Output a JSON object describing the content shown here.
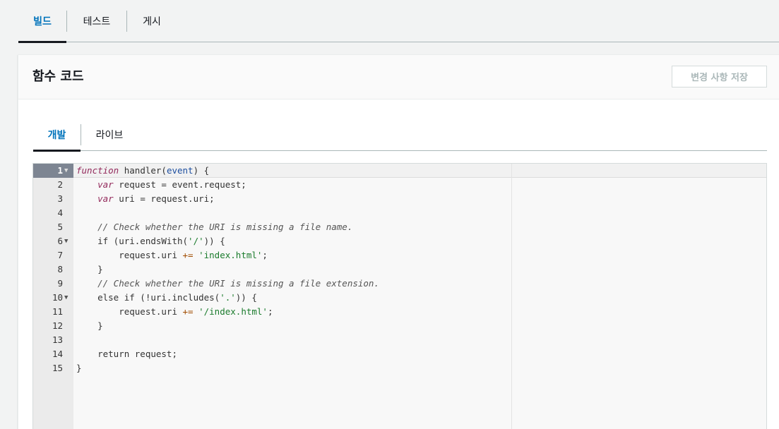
{
  "top_tabs": [
    "빌드",
    "테스트",
    "게시"
  ],
  "panel": {
    "title": "함수 코드",
    "save_label": "변경 사항 저장"
  },
  "inner_tabs": [
    "개발",
    "라이브"
  ],
  "editor": {
    "active_line": 1,
    "lines": [
      {
        "n": "1",
        "fold": "▼",
        "tokens": [
          [
            "kw",
            "function"
          ],
          [
            "t",
            " handler("
          ],
          [
            "param",
            "event"
          ],
          [
            "t",
            ") {"
          ]
        ]
      },
      {
        "n": "2",
        "fold": "",
        "tokens": [
          [
            "t",
            "    "
          ],
          [
            "kw",
            "var"
          ],
          [
            "t",
            " request = event.request;"
          ]
        ]
      },
      {
        "n": "3",
        "fold": "",
        "tokens": [
          [
            "t",
            "    "
          ],
          [
            "kw",
            "var"
          ],
          [
            "t",
            " uri = request.uri;"
          ]
        ]
      },
      {
        "n": "4",
        "fold": "",
        "tokens": []
      },
      {
        "n": "5",
        "fold": "",
        "tokens": [
          [
            "t",
            "    "
          ],
          [
            "cm",
            "// Check whether the URI is missing a file name."
          ]
        ]
      },
      {
        "n": "6",
        "fold": "▼",
        "tokens": [
          [
            "t",
            "    if (uri.endsWith("
          ],
          [
            "str",
            "'/'"
          ],
          [
            "t",
            ")) {"
          ]
        ]
      },
      {
        "n": "7",
        "fold": "",
        "tokens": [
          [
            "t",
            "        request.uri "
          ],
          [
            "op",
            "+="
          ],
          [
            "t",
            " "
          ],
          [
            "str",
            "'index.html'"
          ],
          [
            "t",
            ";"
          ]
        ]
      },
      {
        "n": "8",
        "fold": "",
        "tokens": [
          [
            "t",
            "    }"
          ]
        ]
      },
      {
        "n": "9",
        "fold": "",
        "tokens": [
          [
            "t",
            "    "
          ],
          [
            "cm",
            "// Check whether the URI is missing a file extension."
          ]
        ]
      },
      {
        "n": "10",
        "fold": "▼",
        "tokens": [
          [
            "t",
            "    else if (!uri.includes("
          ],
          [
            "str",
            "'.'"
          ],
          [
            "t",
            ")) {"
          ]
        ]
      },
      {
        "n": "11",
        "fold": "",
        "tokens": [
          [
            "t",
            "        request.uri "
          ],
          [
            "op",
            "+="
          ],
          [
            "t",
            " "
          ],
          [
            "str",
            "'/index.html'"
          ],
          [
            "t",
            ";"
          ]
        ]
      },
      {
        "n": "12",
        "fold": "",
        "tokens": [
          [
            "t",
            "    }"
          ]
        ]
      },
      {
        "n": "13",
        "fold": "",
        "tokens": []
      },
      {
        "n": "14",
        "fold": "",
        "tokens": [
          [
            "t",
            "    return request;"
          ]
        ]
      },
      {
        "n": "15",
        "fold": "",
        "tokens": [
          [
            "t",
            "}"
          ]
        ]
      }
    ]
  }
}
